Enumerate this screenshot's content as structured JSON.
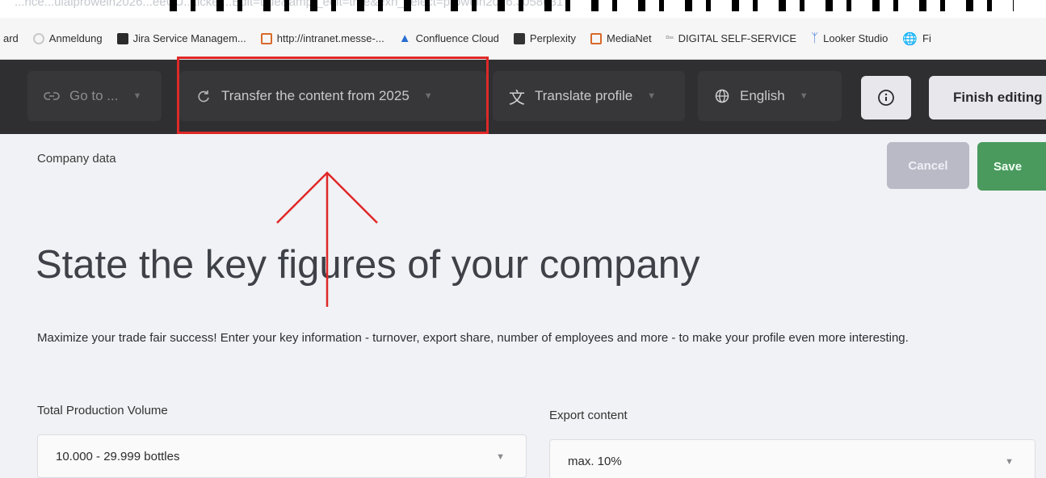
{
  "browser": {
    "url": "...rice...uiaiprowein2026...eeUU...ticket...Edit=true&amp;_edit=true&exh_select=prowein2026.3058631"
  },
  "bookmarks": [
    {
      "label": "ard",
      "icon": "none"
    },
    {
      "label": "Anmeldung",
      "icon": "circle-icon",
      "color": "#c9c9c9"
    },
    {
      "label": "Jira Service Managem...",
      "icon": "jira-icon",
      "color": "#2b2b2b"
    },
    {
      "label": "http://intranet.messe-...",
      "icon": "intranet-icon",
      "color": "#d86a2a"
    },
    {
      "label": "Confluence Cloud",
      "icon": "confluence-icon",
      "color": "#2a6fd1"
    },
    {
      "label": "Perplexity",
      "icon": "perplexity-icon",
      "color": "#333333"
    },
    {
      "label": "MediaNet",
      "icon": "medianet-icon",
      "color": "#d86a2a"
    },
    {
      "label": "DIGITAL SELF-SERVICE",
      "icon": "dss-icon",
      "color": "#555555"
    },
    {
      "label": "Looker Studio",
      "icon": "looker-icon",
      "color": "#4a7fd6"
    },
    {
      "label": "Fi",
      "icon": "globe-icon",
      "color": "#555555"
    }
  ],
  "toolbar": {
    "goto_label": "Go to ...",
    "transfer_label": "Transfer the content from 2025",
    "translate_label": "Translate profile",
    "language_label": "English",
    "finish_label": "Finish editing"
  },
  "page": {
    "section_label": "Company data",
    "cancel_label": "Cancel",
    "save_label": "Save",
    "headline": "State the key figures of your company",
    "intro": "Maximize your trade fair success! Enter your key information - turnover, export share, number of employees and more - to make your profile even more interesting."
  },
  "form": {
    "production_label": "Total Production Volume",
    "production_value": "10.000 - 29.999 bottles",
    "export_label": "Export content",
    "export_value": "max. 10%"
  },
  "colors": {
    "annotation": "#e02828",
    "save": "#4a9a5e",
    "toolbar_bg": "#2f2f31"
  }
}
